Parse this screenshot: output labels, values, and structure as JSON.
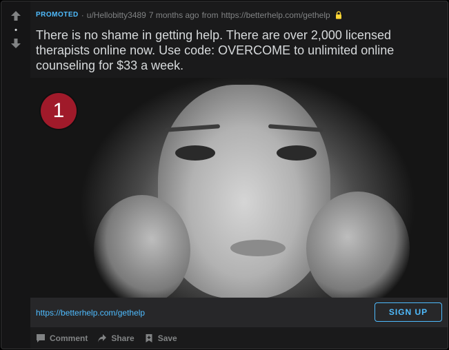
{
  "vote": {
    "score": "•"
  },
  "post": {
    "promoted_label": "PROMOTED",
    "separator": "·",
    "author": "u/Hellobitty3489",
    "time": "7 months ago",
    "from_label": "from",
    "source_url": "https://betterhelp.com/gethelp",
    "title": "There is no shame in getting help. There are over 2,000 licensed therapists online now. Use code: OVERCOME to unlimited online counseling for $33 a week.",
    "image": {
      "badge_number": "1"
    },
    "link": {
      "url": "https://betterhelp.com/gethelp",
      "cta_label": "SIGN UP"
    },
    "actions": {
      "comment": "Comment",
      "share": "Share",
      "save": "Save"
    }
  },
  "colors": {
    "promoted": "#4fbcff",
    "link": "#4fbcff",
    "lock": "#ffd635",
    "badge": "#a01a2a",
    "background": "#1a1a1b"
  }
}
